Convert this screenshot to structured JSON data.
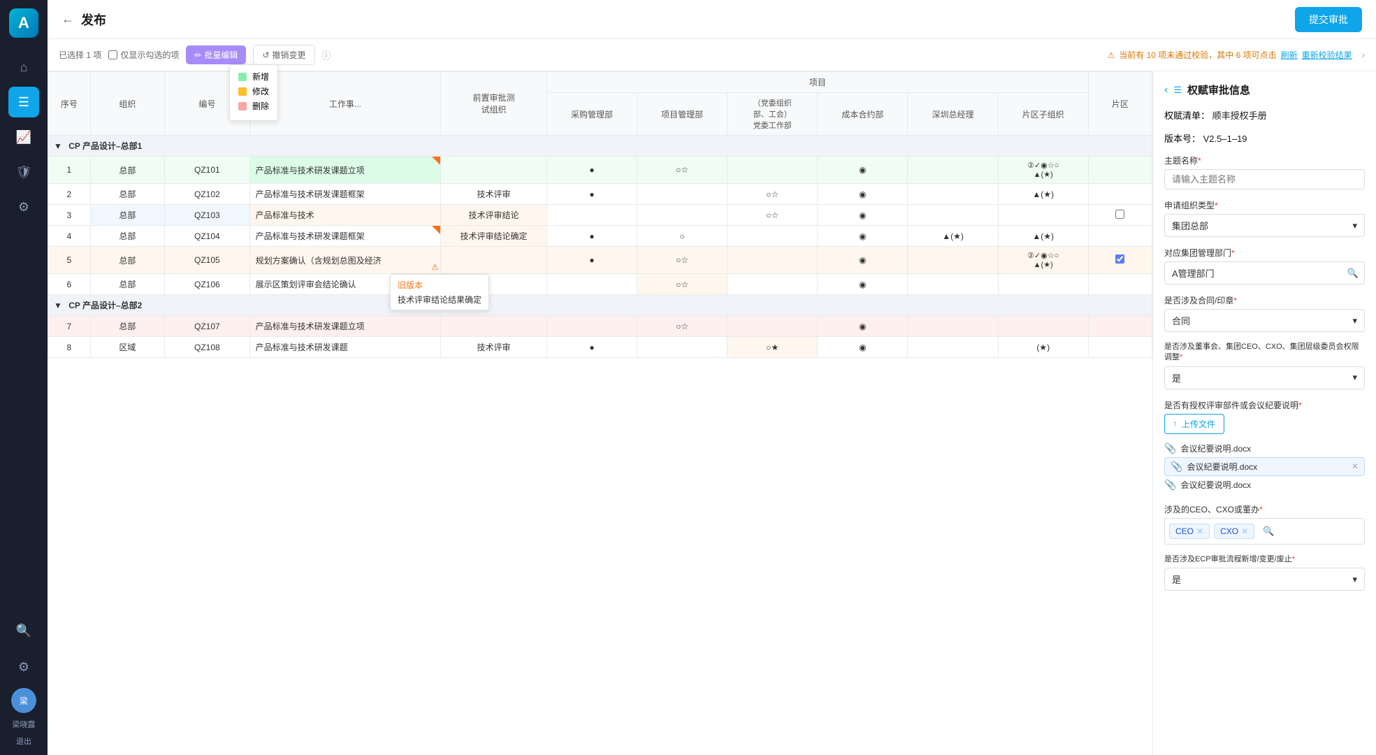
{
  "app": {
    "logo": "A",
    "title": "发布",
    "submit_label": "提交审批"
  },
  "sidebar": {
    "items": [
      {
        "id": "home",
        "icon": "⌂",
        "active": false
      },
      {
        "id": "docs",
        "icon": "☰",
        "active": true
      },
      {
        "id": "chart",
        "icon": "📈",
        "active": false
      },
      {
        "id": "shield",
        "icon": "🛡",
        "active": false
      },
      {
        "id": "settings",
        "icon": "⚙",
        "active": false
      }
    ],
    "bottom": {
      "search_icon": "🔍",
      "settings_icon": "⚙",
      "avatar_text": "梁",
      "user_name": "梁晓露",
      "logout": "退出"
    }
  },
  "toolbar": {
    "selected_info": "已选择 1 项",
    "show_only_selected": "仅显示勾选的项",
    "batch_edit": "批量编辑",
    "cancel_change": "撤销变更",
    "warning_text": "当前有 10 项未通过校验，其中 6 项可点击",
    "refresh_link": "刷新",
    "recheck_link": "重新校验结果"
  },
  "legend": {
    "items": [
      {
        "label": "新增",
        "color": "#86efac"
      },
      {
        "label": "修改",
        "color": "#fbbf24"
      },
      {
        "label": "删除",
        "color": "#fca5a5"
      }
    ]
  },
  "table": {
    "headers": {
      "seq": "序号",
      "org": "组织",
      "code": "编号",
      "work": "工作事...",
      "project_group": "项目",
      "area_group": "片区",
      "pre_review": "前置审批测\n试组织",
      "purchase": "采购管理部",
      "project_mgmt": "项目管理部",
      "party": "（党委组织\n部、工会）\n党委工作部",
      "cost": "成本合约部",
      "shenzhen": "深圳总经理",
      "zone_org": "片区子组织"
    },
    "groups": [
      {
        "id": "g1",
        "name": "CP 产品设计–总部1",
        "rows": [
          {
            "seq": "1",
            "org": "总部",
            "code": "QZ101",
            "work": "产品标准与技术研发课题立项",
            "pre": "",
            "purchase": "●",
            "project": "○☆",
            "party": "",
            "cost": "◉",
            "shenzhen": "",
            "zone": "②✓◉☆○\n▲(★)",
            "style": "green",
            "corner": false,
            "checkbox": false,
            "warning": false
          },
          {
            "seq": "2",
            "org": "总部",
            "code": "QZ102",
            "work": "产品标准与技术研发课题框架",
            "pre": "技术评审",
            "purchase": "●",
            "project": "",
            "party": "○☆",
            "cost": "◉",
            "shenzhen": "",
            "zone": "▲(★)",
            "style": "normal",
            "corner": false,
            "checkbox": false,
            "warning": false
          },
          {
            "seq": "3",
            "org": "总部",
            "code": "QZ103",
            "work": "产品标准与技术",
            "pre": "技术评审结论",
            "purchase": "",
            "project": "",
            "party": "○☆",
            "cost": "◉",
            "shenzhen": "",
            "zone": "",
            "style": "normal",
            "corner": false,
            "checkbox": true,
            "warning": false,
            "tooltip": {
              "old": "旧版本",
              "new": "技术评审结论结果确定"
            }
          },
          {
            "seq": "4",
            "org": "总部",
            "code": "QZ104",
            "work": "产品标准与技术研发课题框架",
            "pre": "技术评审结论确定",
            "purchase": "●",
            "project": "○",
            "party": "",
            "cost": "◉",
            "shenzhen": "▲(★)",
            "zone": "▲(★)",
            "style": "normal",
            "corner": true,
            "checkbox": false,
            "warning": false
          },
          {
            "seq": "5",
            "org": "总部",
            "code": "QZ105",
            "work": "规划方案确认（含规划总图及经济",
            "pre": "",
            "purchase": "●",
            "project": "○☆",
            "party": "",
            "cost": "◉",
            "shenzhen": "",
            "zone": "②✓◉☆○\n▲(★)",
            "style": "orange",
            "corner": false,
            "checkbox": true,
            "warning": true
          },
          {
            "seq": "6",
            "org": "总部",
            "code": "QZ106",
            "work": "展示区策划评审会结论确认",
            "pre": "",
            "purchase": "",
            "project": "○☆",
            "party": "",
            "cost": "◉",
            "shenzhen": "",
            "zone": "",
            "style": "normal",
            "corner": false,
            "checkbox": false,
            "warning": false
          }
        ]
      },
      {
        "id": "g2",
        "name": "CP 产品设计–总部2",
        "rows": [
          {
            "seq": "7",
            "org": "总部",
            "code": "QZ107",
            "work": "产品标准与技术研发课题立项",
            "pre": "",
            "purchase": "",
            "project": "○☆",
            "party": "",
            "cost": "◉",
            "shenzhen": "",
            "zone": "",
            "style": "pink",
            "corner": false,
            "checkbox": false,
            "warning": false
          },
          {
            "seq": "8",
            "org": "区域",
            "code": "QZ108",
            "work": "产品标准与技术研发课题",
            "pre": "技术评审",
            "purchase": "●",
            "project": "",
            "party": "○★",
            "cost": "◉",
            "shenzhen": "",
            "zone": "(★)",
            "style": "normal",
            "corner": false,
            "checkbox": false,
            "warning": false
          }
        ]
      }
    ]
  },
  "right_panel": {
    "title": "权赋审批信息",
    "list_label": "权赋清单：",
    "list_value": "顺丰授权手册",
    "version_label": "版本号：",
    "version_value": "V2.5–1–19",
    "topic_label": "主题名称",
    "topic_placeholder": "请输入主题名称",
    "org_type_label": "申请组织类型",
    "org_type_value": "集团总部",
    "mgmt_dept_label": "对应集团管理部门",
    "mgmt_dept_value": "A管理部门",
    "contract_label": "是否涉及合同/印章",
    "contract_value": "合同",
    "board_label": "是否涉及董事会、集团CEO、CXO、集团层级委员会权限调整",
    "board_value": "是",
    "authorized_label": "是否有授权评审部件或会议纪要说明",
    "upload_label": "上传文件",
    "files": [
      {
        "name": "会议纪要说明.docx",
        "active": false
      },
      {
        "name": "会议纪要说明.docx",
        "active": true
      },
      {
        "name": "会议纪要说明.docx",
        "active": false
      }
    ],
    "ceo_label": "涉及的CEO、CXO或董办",
    "tags": [
      {
        "label": "CEO"
      },
      {
        "label": "CXO"
      }
    ],
    "ecp_label": "是否涉及ECP审批流程新增/变更/废止",
    "ecp_value": "是"
  }
}
